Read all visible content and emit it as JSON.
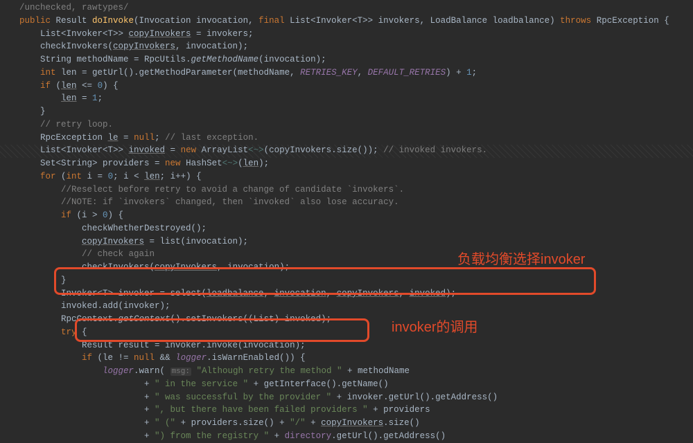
{
  "code": {
    "l0": "/unchecked, rawtypes/",
    "l1_public": "public",
    "l1_ret": " Result ",
    "l1_name": "doInvoke",
    "l1_args": "(Invocation invocation, ",
    "l1_final": "final",
    "l1_args2": " List<Invoker<T>> invokers, LoadBalance loadbalance) ",
    "l1_throws": "throws",
    "l1_exc": " RpcException {",
    "l2": "    List<Invoker<T>> ",
    "l2_var": "copyInvokers",
    "l2_end": " = invokers;",
    "l3": "    checkInvokers(",
    "l3_var": "copyInvokers",
    "l3_end": ", invocation);",
    "l4": "    String methodName = RpcUtils.",
    "l4_call": "getMethodName",
    "l4_end": "(invocation);",
    "l5_int": "    int",
    "l5_a": " len = getUrl().getMethodParameter(methodName, ",
    "l5_c1": "RETRIES_KEY",
    "l5_m": ", ",
    "l5_c2": "DEFAULT_RETRIES",
    "l5_end": ") + ",
    "l5_1": "1",
    "l5_semi": ";",
    "l6_if": "    if",
    "l6_a": " (",
    "l6_len": "len",
    "l6_cmp": " <= ",
    "l6_0": "0",
    "l6_b": ") {",
    "l7_a": "        ",
    "l7_len": "len",
    "l7_eq": " = ",
    "l7_1": "1",
    "l7_s": ";",
    "l8": "    }",
    "l9": "    // retry loop.",
    "l10_a": "    RpcException ",
    "l10_le": "le",
    "l10_eq": " = ",
    "l10_null": "null",
    "l10_s": "; ",
    "l10_c": "// last exception.",
    "l11_a": "    List<Invoker<T>> ",
    "l11_inv": "invoked",
    "l11_eq": " = ",
    "l11_new": "new",
    "l11_al": " ArrayList",
    "l11_di": "<~>",
    "l11_p": "(copyInvokers.size()); ",
    "l11_c": "// invoked invokers.",
    "l12_a": "    Set<String> providers = ",
    "l12_new": "new",
    "l12_hs": " HashSet",
    "l12_di": "<~>",
    "l12_p": "(",
    "l12_len": "len",
    "l12_e": ");",
    "l13_for": "    for",
    "l13_a": " (",
    "l13_int": "int",
    "l13_b": " i = ",
    "l13_0": "0",
    "l13_c": "; i < ",
    "l13_len": "len",
    "l13_d": "; i++) {",
    "l14": "        //Reselect before retry to avoid a change of candidate `invokers`.",
    "l15": "        //NOTE: if `invokers` changed, then `invoked` also lose accuracy.",
    "l16_if": "        if",
    "l16_a": " (i > ",
    "l16_0": "0",
    "l16_b": ") {",
    "l17": "            checkWhetherDestroyed();",
    "l18_a": "            ",
    "l18_ci": "copyInvokers",
    "l18_b": " = list(invocation);",
    "l19": "            // check again",
    "l20_a": "            checkInvokers(",
    "l20_ci": "copyInvokers",
    "l20_b": ", invocation);",
    "l21": "        }",
    "l22_a": "        Invoker<T> invoker = select(",
    "l22_lb": "loadbalance",
    "l22_m1": ", ",
    "l22_iv": "invocation",
    "l22_m2": ", ",
    "l22_ci": "copyInvokers",
    "l22_m3": ", ",
    "l22_id": "invoked",
    "l22_e": ");",
    "l23": "        invoked.add(invoker);",
    "l24_a": "        RpcContext.",
    "l24_gc": "getContext",
    "l24_b": "().setInvokers((List) invoked);",
    "l25_try": "        try",
    "l25_b": " {",
    "l26": "            Result result = invoker.invoke(invocation);",
    "l27_a": "            ",
    "l27_if": "if",
    "l27_b": " (le != ",
    "l27_null": "null",
    "l27_c": " && ",
    "l27_lg": "logger",
    "l27_d": ".isWarnEnabled()) {",
    "l28_a": "                ",
    "l28_lg": "logger",
    "l28_b": ".warn( ",
    "l28_h": "msg:",
    "l28_s": " \"Although retry the method \"",
    "l28_c": " + methodName",
    "l29_a": "                        + ",
    "l29_s": "\" in the service \"",
    "l29_b": " + getInterface().getName()",
    "l30_a": "                        + ",
    "l30_s": "\" was successful by the provider \"",
    "l30_b": " + invoker.getUrl().getAddress()",
    "l31_a": "                        + ",
    "l31_s": "\", but there have been failed providers \"",
    "l31_b": " + providers",
    "l32_a": "                        + ",
    "l32_s1": "\" (\"",
    "l32_b": " + providers.size() + ",
    "l32_s2": "\"/\"",
    "l32_c": " + ",
    "l32_ci": "copyInvokers",
    "l32_d": ".size()",
    "l33_a": "                        + ",
    "l33_s": "\") from the registry \"",
    "l33_b": " + ",
    "l33_dir": "directory",
    "l33_c": ".getUrl().getAddress()"
  },
  "annotations": {
    "label1": "负载均衡选择invoker",
    "label2": "invoker的调用"
  }
}
